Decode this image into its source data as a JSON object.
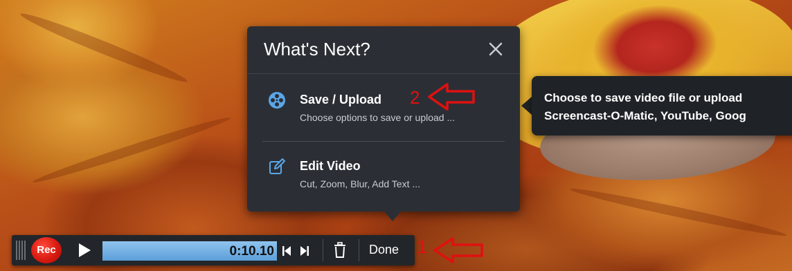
{
  "popup": {
    "title": "What's Next?",
    "items": [
      {
        "label": "Save / Upload",
        "description": "Choose options to save or upload ..."
      },
      {
        "label": "Edit Video",
        "description": "Cut, Zoom, Blur, Add Text ..."
      }
    ]
  },
  "tooltip": {
    "line1": "Choose to save video file or upload",
    "line2": "Screencast-O-Matic, YouTube, Goog"
  },
  "recorder": {
    "rec_label": "Rec",
    "time": "0:10.10",
    "progress": 1.0,
    "done_label": "Done"
  },
  "annotations": {
    "step1": "1",
    "step2": "2"
  },
  "colors": {
    "popup_bg": "#2b2f35",
    "accent_blue": "#5aa6e8",
    "rec_red": "#d81a10",
    "annotation_red": "#e01010"
  },
  "icons": {
    "save": "film-reel-icon",
    "edit": "edit-pencil-icon",
    "close": "close-icon",
    "trash": "trash-icon"
  }
}
